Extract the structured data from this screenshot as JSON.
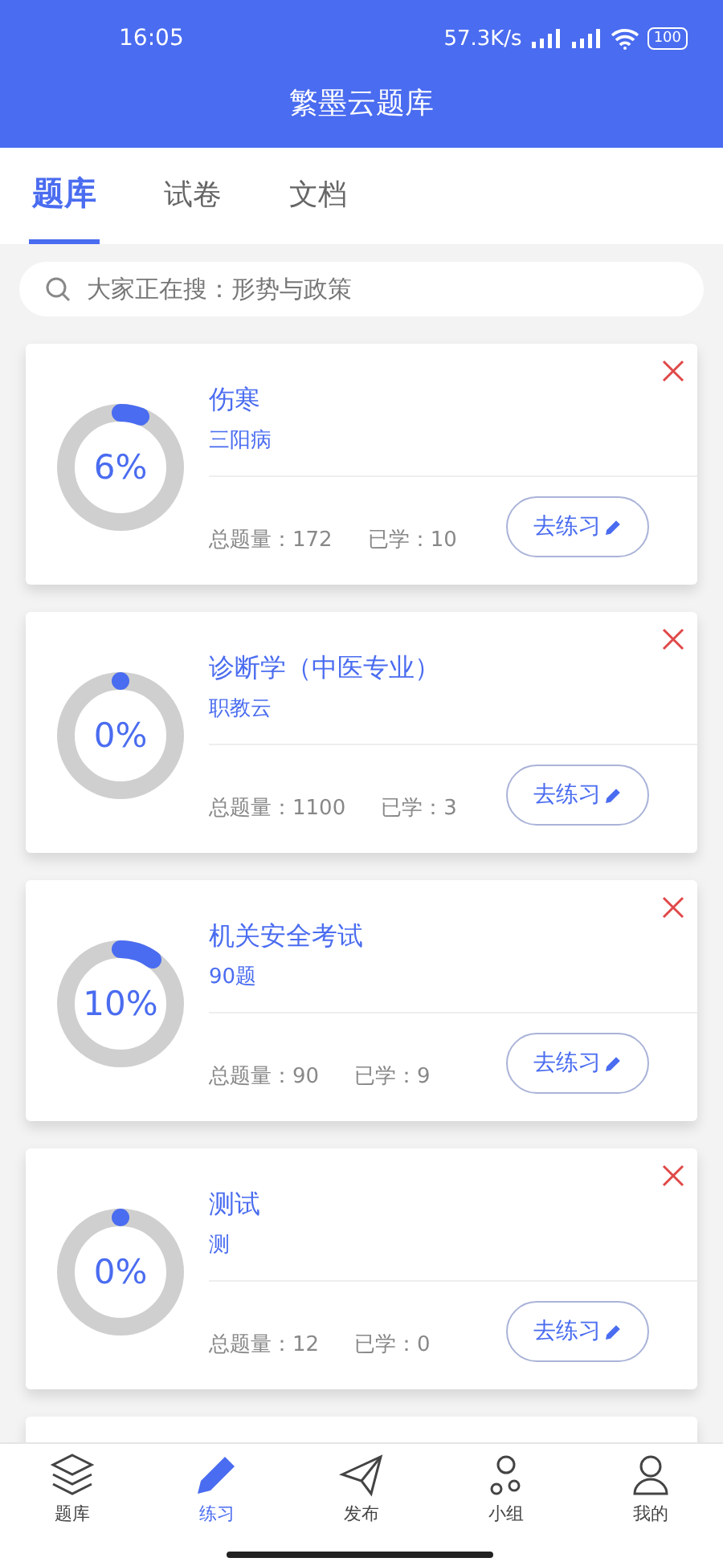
{
  "status_bar": {
    "time": "16:05",
    "speed": "57.3K/s",
    "battery": "100"
  },
  "header": {
    "title": "繁墨云题库"
  },
  "tabs": [
    {
      "label": "题库",
      "selected": true
    },
    {
      "label": "试卷",
      "selected": false
    },
    {
      "label": "文档",
      "selected": false
    }
  ],
  "search": {
    "placeholder": "大家正在搜：形势与政策"
  },
  "cards": [
    {
      "title": "伤寒",
      "subtitle": "三阳病",
      "level": 0.06,
      "percent": "6%",
      "total": "总题量：172",
      "learned": "已学：10",
      "button": "去练习"
    },
    {
      "title": "诊断学（中医专业）",
      "subtitle": "职教云",
      "level": 0,
      "percent": "0%",
      "total": "总题量：1100",
      "learned": "已学：3",
      "button": "去练习"
    },
    {
      "title": "机关安全考试",
      "subtitle": "90题",
      "level": 0.1,
      "percent": "10%",
      "total": "总题量：90",
      "learned": "已学：9",
      "button": "去练习"
    },
    {
      "title": "测试",
      "subtitle": "测",
      "level": 0,
      "percent": "0%",
      "total": "总题量：12",
      "learned": "已学：0",
      "button": "去练习"
    }
  ],
  "nav": [
    {
      "kind": "layers",
      "label": "题库",
      "selected": false
    },
    {
      "kind": "pencil",
      "label": "练习",
      "selected": true
    },
    {
      "kind": "plane",
      "label": "发布",
      "selected": false
    },
    {
      "kind": "group",
      "label": "小组",
      "selected": false
    },
    {
      "kind": "person",
      "label": "我的",
      "selected": false
    }
  ]
}
